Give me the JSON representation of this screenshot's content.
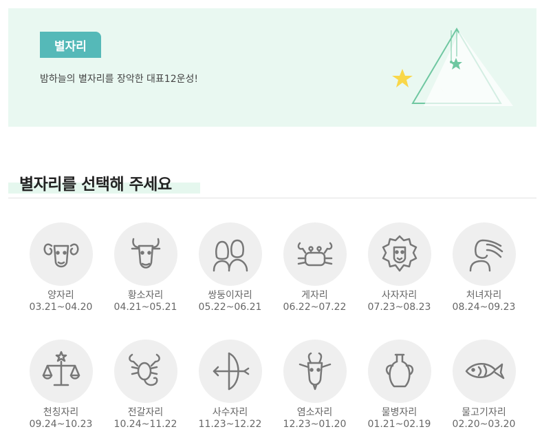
{
  "banner": {
    "badge": "별자리",
    "description": "밤하늘의 별자리를 장악한 대표12운성!"
  },
  "section": {
    "title": "별자리를 선택해 주세요"
  },
  "colors": {
    "banner_bg": "#e9f8f1",
    "badge_bg": "#55b9b8",
    "moon": "#f9d749",
    "triangle": "#6fc7a1",
    "icon_circle": "#efefef",
    "icon_stroke": "#777777"
  },
  "signs": [
    {
      "name": "양자리",
      "dates": "03.21~04.20",
      "icon": "aries-ram-icon"
    },
    {
      "name": "황소자리",
      "dates": "04.21~05.21",
      "icon": "taurus-bull-icon"
    },
    {
      "name": "쌍둥이자리",
      "dates": "05.22~06.21",
      "icon": "gemini-twins-icon"
    },
    {
      "name": "게자리",
      "dates": "06.22~07.22",
      "icon": "cancer-crab-icon"
    },
    {
      "name": "사자자리",
      "dates": "07.23~08.23",
      "icon": "leo-lion-icon"
    },
    {
      "name": "처녀자리",
      "dates": "08.24~09.23",
      "icon": "virgo-maiden-icon"
    },
    {
      "name": "천칭자리",
      "dates": "09.24~10.23",
      "icon": "libra-scales-icon"
    },
    {
      "name": "전갈자리",
      "dates": "10.24~11.22",
      "icon": "scorpio-scorpion-icon"
    },
    {
      "name": "사수자리",
      "dates": "11.23~12.22",
      "icon": "sagittarius-bow-icon"
    },
    {
      "name": "염소자리",
      "dates": "12.23~01.20",
      "icon": "capricorn-goat-icon"
    },
    {
      "name": "물병자리",
      "dates": "01.21~02.19",
      "icon": "aquarius-vase-icon"
    },
    {
      "name": "물고기자리",
      "dates": "02.20~03.20",
      "icon": "pisces-fish-icon"
    }
  ]
}
